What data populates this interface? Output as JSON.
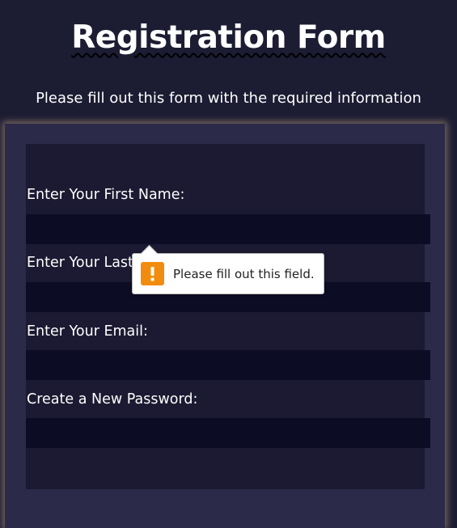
{
  "header": {
    "title": "Registration Form",
    "subtitle": "Please fill out this form with the required information"
  },
  "form": {
    "fields": [
      {
        "label": "Enter Your First Name:",
        "value": "",
        "placeholder": ""
      },
      {
        "label": "Enter Your Last Name:",
        "value": "",
        "placeholder": ""
      },
      {
        "label": "Enter Your Email:",
        "value": "",
        "placeholder": ""
      },
      {
        "label": "Create a New Password:",
        "value": "",
        "placeholder": ""
      }
    ]
  },
  "validation_tooltip": {
    "message": "Please fill out this field.",
    "icon": "exclamation-warning-icon"
  },
  "colors": {
    "background": "#1c1c33",
    "form_frame": "#2b2a48",
    "form_panel": "#1b1a32",
    "input_fill": "#0c0c25",
    "warning_icon": "#f28c0e"
  }
}
